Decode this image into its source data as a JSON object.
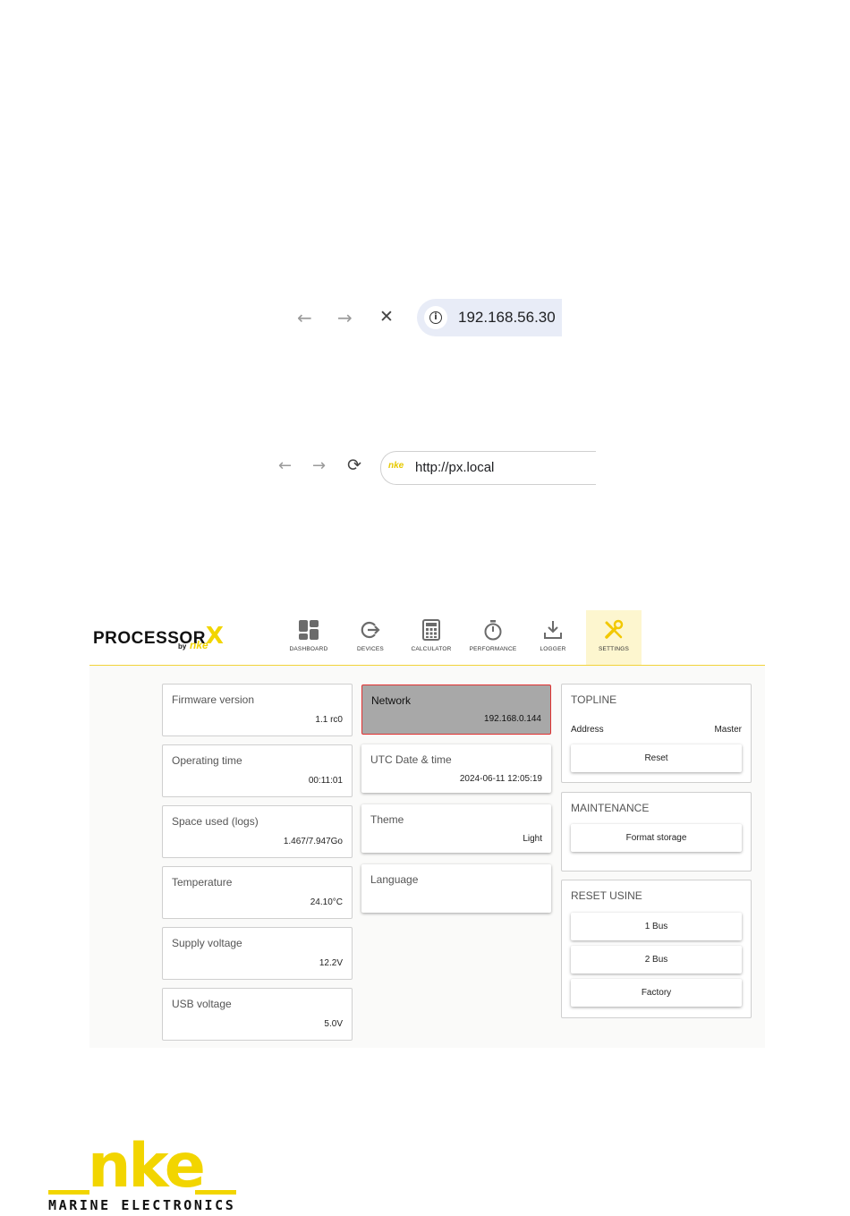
{
  "browser_bar_1": {
    "back": "←",
    "forward": "→",
    "stop": "✕",
    "url": "192.168.56.30"
  },
  "browser_bar_2": {
    "back": "←",
    "forward": "→",
    "reload": "⟳",
    "favicon_text": "nke",
    "url": "http://px.local"
  },
  "app": {
    "brand": {
      "name": "PROCESSOR",
      "x": "X",
      "by": "by",
      "nke": "nke"
    },
    "nav": [
      {
        "label": "DASHBOARD",
        "icon": "dashboard-icon"
      },
      {
        "label": "DEVICES",
        "icon": "devices-icon"
      },
      {
        "label": "CALCULATOR",
        "icon": "calculator-icon"
      },
      {
        "label": "PERFORMANCE",
        "icon": "stopwatch-icon"
      },
      {
        "label": "LOGGER",
        "icon": "download-icon"
      },
      {
        "label": "SETTINGS",
        "icon": "tools-icon",
        "active": true
      }
    ],
    "info_cards": [
      {
        "title": "Firmware version",
        "value": "1.1 rc0"
      },
      {
        "title": "Operating time",
        "value": "00:11:01"
      },
      {
        "title": "Space used (logs)",
        "value": "1.467/7.947Go"
      },
      {
        "title": "Temperature",
        "value": "24.10°C"
      },
      {
        "title": "Supply voltage",
        "value": "12.2V"
      },
      {
        "title": "USB voltage",
        "value": "5.0V"
      }
    ],
    "settings_cards": [
      {
        "title": "Network",
        "value": "192.168.0.144"
      },
      {
        "title": "UTC Date & time",
        "value": "2024-06-11 12:05:19"
      },
      {
        "title": "Theme",
        "value": "Light"
      },
      {
        "title": "Language",
        "value": ""
      }
    ],
    "topline": {
      "title": "TOPLINE",
      "address_label": "Address",
      "address_value": "Master",
      "reset": "Reset"
    },
    "maintenance": {
      "title": "MAINTENANCE",
      "format": "Format storage"
    },
    "reset_usine": {
      "title": "RESET USINE",
      "buttons": [
        "1 Bus",
        "2 Bus",
        "Factory"
      ]
    }
  },
  "logo": {
    "nke": "nke",
    "subtitle": "MARINE ELECTRONICS"
  },
  "colors": {
    "brand_yellow": "#f2d500",
    "selected_border": "#e03030",
    "selected_bg": "#a8a8a8"
  }
}
